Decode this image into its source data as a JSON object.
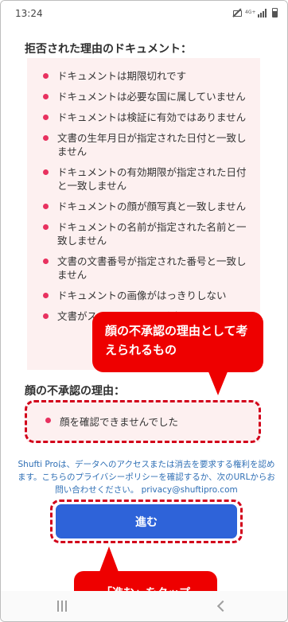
{
  "status_bar": {
    "time": "13:24",
    "network_label": "4G+"
  },
  "documents_section": {
    "title": "拒否された理由のドキュメント：",
    "reasons": [
      "ドキュメントは期限切れです",
      "ドキュメントは必要な国に属していません",
      "ドキュメントは検証に有効ではありません",
      "文書の生年月日が指定された日付と一致しません",
      "ドキュメントの有効期限が指定された日付と一致しません",
      "ドキュメントの顔が顔写真と一致しません",
      "ドキュメントの名前が指定された名前と一致しません",
      "文書の文書番号が指定された番号と一致しません",
      "ドキュメントの画像がはっきりしない",
      "文書がス いる、ま チャされ"
    ]
  },
  "face_section": {
    "title": "顔の不承認の理由：",
    "reason": "顔を確認できませんでした"
  },
  "privacy": {
    "text": "Shufti Proは、データへのアクセスまたは消去を要求する権利を認めます。こちらのプライバシーポリシーを確認するか、次のURLからお問い合わせください。 privacy@shuftipro.com"
  },
  "proceed_button": {
    "label": "進む"
  },
  "annotations": {
    "face_callout": "顔の不承認の理由として考えられるもの",
    "tap_callout": "「進む」をタップ"
  },
  "colors": {
    "accent_red": "#ee0000",
    "bullet_pink": "#e8315f",
    "button_blue": "#2e63d9",
    "link_blue": "#2f6fb5",
    "reasons_bg": "#fdf0f0"
  }
}
